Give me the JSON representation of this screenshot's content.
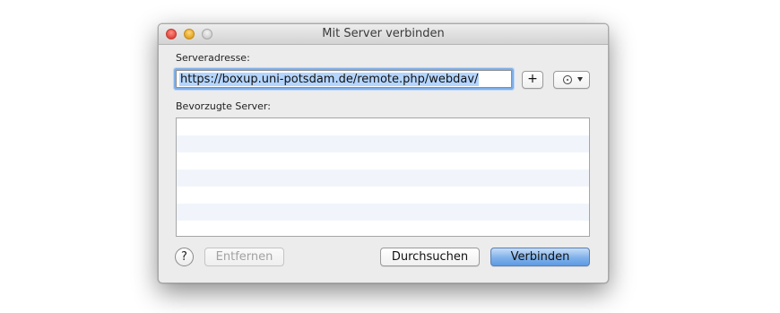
{
  "window": {
    "title": "Mit Server verbinden"
  },
  "traffic_lights": [
    "close",
    "minimize",
    "zoom"
  ],
  "server": {
    "label": "Serveradresse:",
    "value": "https://boxup.uni-potsdam.de/remote.php/webdav/"
  },
  "buttons": {
    "add_label": "+",
    "remove_label": "Entfernen",
    "browse_label": "Durchsuchen",
    "connect_label": "Verbinden",
    "help_label": "?"
  },
  "favorites": {
    "label": "Bevorzugte Server:",
    "items": []
  },
  "icons": {
    "add": "plus-icon",
    "recent": "clock-icon",
    "help": "question-icon"
  },
  "colors": {
    "selection": "#b4d5fe",
    "focus_ring": "#7eaee8",
    "default_button": "#7fb1ea",
    "close": "#e2463d",
    "minimize": "#e3a525"
  }
}
